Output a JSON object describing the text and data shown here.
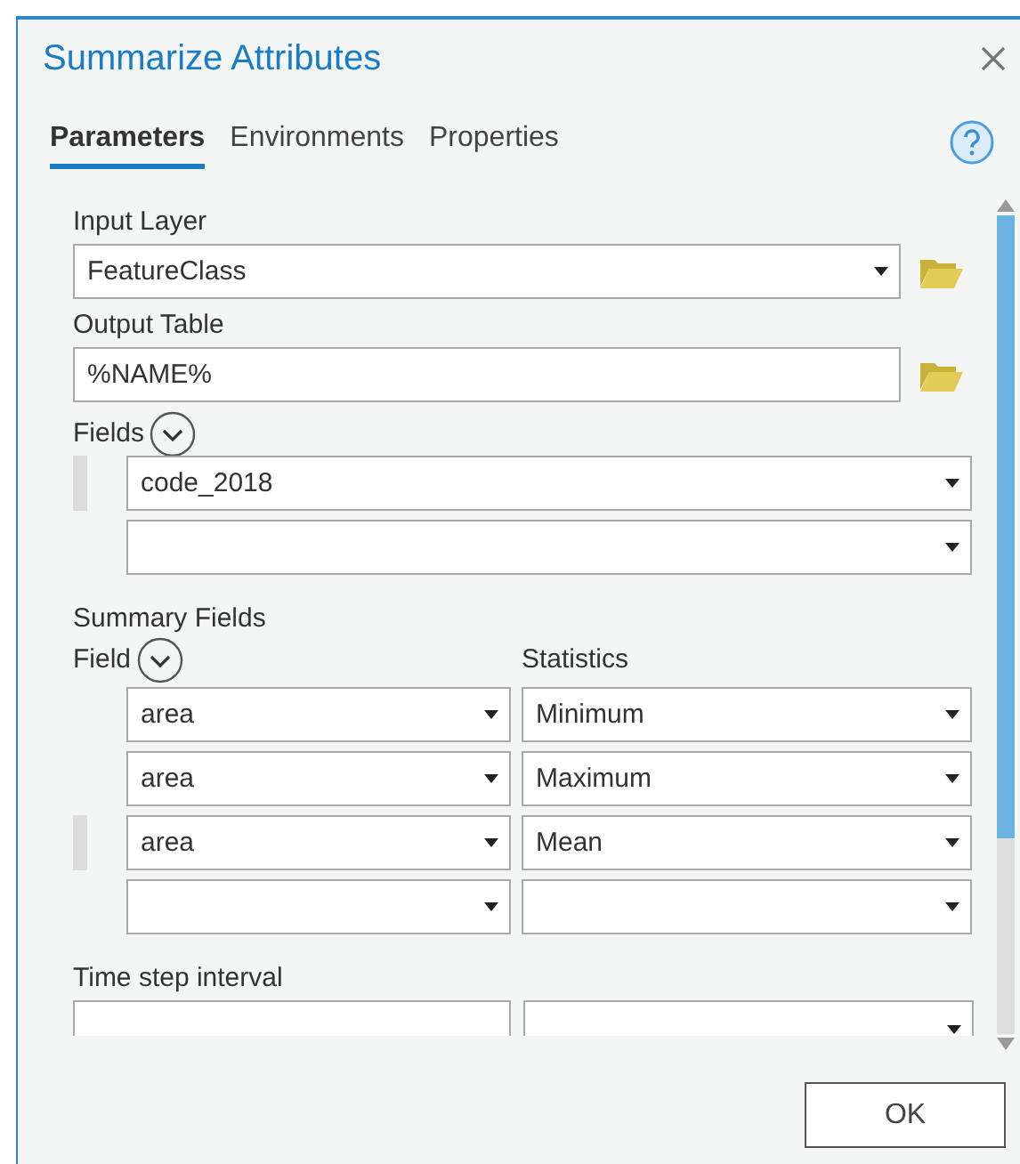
{
  "window": {
    "title": "Summarize Attributes"
  },
  "tabs": [
    {
      "label": "Parameters",
      "selected": true
    },
    {
      "label": "Environments",
      "selected": false
    },
    {
      "label": "Properties",
      "selected": false
    }
  ],
  "input_layer": {
    "label": "Input Layer",
    "value": "FeatureClass"
  },
  "output_table": {
    "label": "Output Table",
    "value": "%NAME%"
  },
  "fields": {
    "label": "Fields",
    "rows": [
      {
        "value": "code_2018",
        "highlighted": true
      },
      {
        "value": "",
        "highlighted": false
      }
    ]
  },
  "summary_fields": {
    "label": "Summary Fields",
    "field_label": "Field",
    "statistics_label": "Statistics",
    "rows": [
      {
        "field": "area",
        "statistic": "Minimum",
        "highlighted": false
      },
      {
        "field": "area",
        "statistic": "Maximum",
        "highlighted": false
      },
      {
        "field": "area",
        "statistic": "Mean",
        "highlighted": true
      },
      {
        "field": "",
        "statistic": "",
        "highlighted": false
      }
    ]
  },
  "time_step_interval": {
    "label": "Time step interval"
  },
  "buttons": [
    {
      "label": "OK"
    }
  ]
}
